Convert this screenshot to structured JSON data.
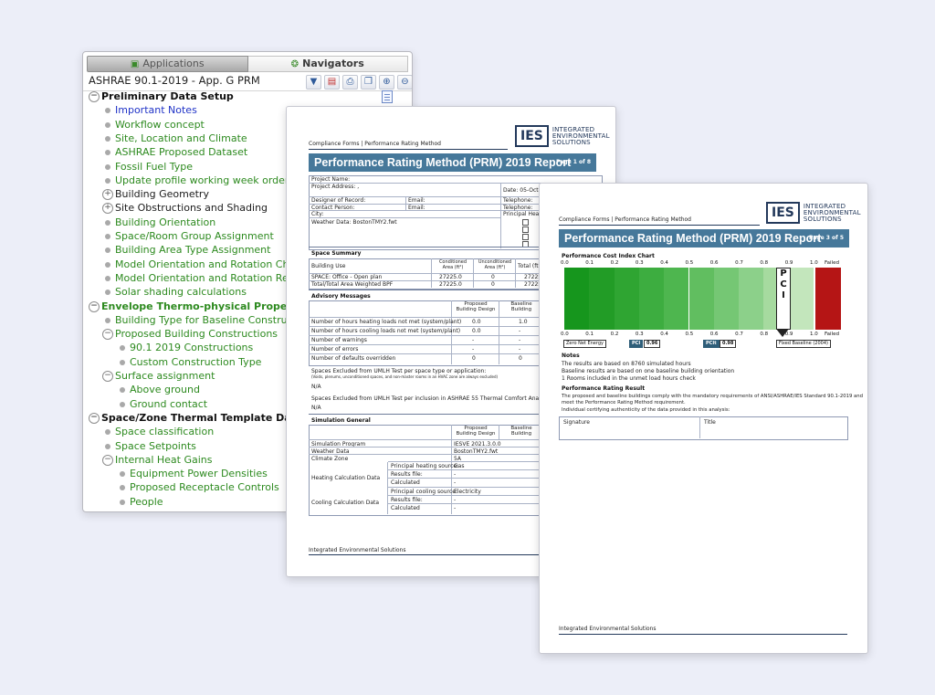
{
  "navigator": {
    "tab_applications": "Applications",
    "tab_navigators": "Navigators",
    "toolbar_title": "ASHRAE 90.1-2019 - App. G PRM",
    "items": [
      {
        "label": "Preliminary Data Setup",
        "style": "h",
        "indent": 0,
        "toggle": "⊖"
      },
      {
        "label": "Important Notes",
        "style": "b",
        "indent": 1
      },
      {
        "label": "Workflow concept",
        "style": "g",
        "indent": 1
      },
      {
        "label": "Site, Location and Climate",
        "style": "g",
        "indent": 1
      },
      {
        "label": "ASHRAE Proposed Dataset",
        "style": "g",
        "indent": 1
      },
      {
        "label": "Fossil Fuel Type",
        "style": "g",
        "indent": 1
      },
      {
        "label": "Update profile working week order",
        "style": "g",
        "indent": 1
      },
      {
        "label": "Building Geometry",
        "style": "k",
        "indent": 1,
        "toggle": "⊕"
      },
      {
        "label": "Site Obstructions and Shading",
        "style": "k",
        "indent": 1,
        "toggle": "⊕"
      },
      {
        "label": "Building Orientation",
        "style": "g",
        "indent": 1
      },
      {
        "label": "Space/Room Group Assignment",
        "style": "g",
        "indent": 1
      },
      {
        "label": "Building Area Type Assignment",
        "style": "g",
        "indent": 1
      },
      {
        "label": "Model Orientation and Rotation Check",
        "style": "g",
        "indent": 1
      },
      {
        "label": "Model Orientation and Rotation Report",
        "style": "g",
        "indent": 1
      },
      {
        "label": "Solar shading calculations",
        "style": "g",
        "indent": 1
      },
      {
        "label": "Envelope Thermo-physical Properties",
        "style": "hg",
        "indent": 0,
        "toggle": "⊖"
      },
      {
        "label": "Building Type for Baseline Construction A",
        "style": "g",
        "indent": 1
      },
      {
        "label": "Proposed Building Constructions",
        "style": "g",
        "indent": 1,
        "toggle": "⊖"
      },
      {
        "label": "90.1 2019 Constructions",
        "style": "g",
        "indent": 2
      },
      {
        "label": "Custom Construction Type",
        "style": "g",
        "indent": 2
      },
      {
        "label": "Surface assignment",
        "style": "g",
        "indent": 1,
        "toggle": "⊖"
      },
      {
        "label": "Above ground",
        "style": "g",
        "indent": 2
      },
      {
        "label": "Ground contact",
        "style": "g",
        "indent": 2
      },
      {
        "label": "Space/Zone Thermal Template Data",
        "style": "h",
        "indent": 0,
        "toggle": "⊖"
      },
      {
        "label": "Space classification",
        "style": "g",
        "indent": 1
      },
      {
        "label": "Space Setpoints",
        "style": "g",
        "indent": 1
      },
      {
        "label": "Internal Heat Gains",
        "style": "g",
        "indent": 1,
        "toggle": "⊖"
      },
      {
        "label": "Equipment Power Densities",
        "style": "g",
        "indent": 2
      },
      {
        "label": "Proposed Receptacle Controls",
        "style": "g",
        "indent": 2
      },
      {
        "label": "People",
        "style": "g",
        "indent": 2
      }
    ]
  },
  "report1": {
    "header_left": "Compliance Forms | Performance Rating Method",
    "logo": "IES",
    "logo_line1": "INTEGRATED",
    "logo_line2": "ENVIRONMENTAL",
    "logo_line3": "SOLUTIONS",
    "title": "Performance Rating Method (PRM) 2019 Report",
    "page": "Page 1 of 8",
    "project_name": "Project Name:",
    "project_address": "Project Address: ,",
    "date": "Date: 05-Oct-2021",
    "designer": "Designer of Record:",
    "contact": "Contact Person:",
    "email": "Email:",
    "telephone": "Telephone:",
    "city": "City:",
    "weather": "Weather Data: BostonTMY2.fwt",
    "principal_heating": "Principal Heating S",
    "space_summary": "Space Summary",
    "ss_building_use": "Building Use",
    "ss_conditioned": "Conditioned Area (ft²)",
    "ss_unconditioned": "Unconditioned Area (ft²)",
    "ss_total": "Total (ft²)",
    "ss_row1": [
      "SPACE: Office - Open plan",
      "27225.0",
      "0",
      "27225"
    ],
    "ss_row2": [
      "Total/Total Area Weighted BPF",
      "27225.0",
      "0",
      "27225"
    ],
    "advisory": "Advisory Messages",
    "adv_h1": "Proposed Building Design",
    "adv_h2": "Baseline Building",
    "adv_rows": [
      [
        "Number of hours heating loads not met (system/plant)",
        "0.0",
        "1.0"
      ],
      [
        "Number of hours cooling loads not met (system/plant)",
        "0.0",
        "-"
      ],
      [
        "Number of warnings",
        "-",
        "-"
      ],
      [
        "Number of errors",
        "-",
        "-"
      ],
      [
        "Number of defaults overridden",
        "0",
        "0"
      ]
    ],
    "excluded1": "Spaces Excluded from UMLH Test per space type or application:",
    "excluded1_note": "(Voids, plenums, unconditioned spaces, and non-master rooms in an HVAC zone are always excluded)",
    "na1": "N/A",
    "excluded2": "Spaces Excluded from UMLH Test per inclusion in ASHRAE 55 Thermal Comfort Analysis:",
    "na2": "N/A",
    "sim_general": "Simulation General",
    "sim_rows": [
      [
        "Simulation Program",
        "IESVE 2021.3.0.0"
      ],
      [
        "Weather Data",
        "BostonTMY2.fwt"
      ],
      [
        "Climate Zone",
        "5A"
      ]
    ],
    "heating_calc": "Heating Calculation Data",
    "cooling_calc": "Cooling Calculation Data",
    "heat_rows": [
      [
        "Principal heating source:",
        "Gas"
      ],
      [
        "Results file:",
        "-"
      ],
      [
        "Calculated",
        "-"
      ]
    ],
    "cool_rows": [
      [
        "Principal cooling source:",
        "Electricity"
      ],
      [
        "Results file:",
        "-"
      ],
      [
        "Calculated",
        "-"
      ]
    ],
    "footer": "Integrated Environmental Solutions"
  },
  "report2": {
    "header_left": "Compliance Forms | Performance Rating Method",
    "logo": "IES",
    "logo_line1": "INTEGRATED",
    "logo_line2": "ENVIRONMENTAL",
    "logo_line3": "SOLUTIONS",
    "title": "Performance Rating Method (PRM) 2019 Report",
    "page": "Page 3 of 5",
    "chart_title": "Performance Cost Index Chart",
    "ticks": [
      "0.0",
      "0.1",
      "0.2",
      "0.3",
      "0.4",
      "0.5",
      "0.6",
      "0.7",
      "0.8",
      "0.9",
      "1.0"
    ],
    "failed": "Failed",
    "pci_letters": [
      "P",
      "C",
      "I"
    ],
    "zero_net": "Zero Net Energy",
    "pci_label": "PCI",
    "pci_value": "0.96",
    "pcit_label": "PCIt",
    "pcit_value": "0.98",
    "fixed_baseline": "Fixed Baseline (2004)",
    "notes": "Notes",
    "note1": "The results are based on 8760 simulated hours",
    "note2": "Baseline results are based on one baseline building orientation",
    "note3": "1 Rooms included in the unmet load hours check",
    "result_title": "Performance Rating Result",
    "result1": "The proposed and baseline buildings comply with the mandatory requirements of ANSI/ASHRAE/IES Standard 90.1-2019 and",
    "result2": "meet the Performance Rating Method requirement.",
    "result3": "Individual certifying authenticity of the data provided in this analysis:",
    "signature": "Signature",
    "title_col": "Title",
    "footer": "Integrated Environmental Solutions",
    "colors": {
      "scale": [
        "#16961d",
        "#229c26",
        "#2fa532",
        "#3dad40",
        "#4eb64f",
        "#61be60",
        "#75c774",
        "#8cd08a",
        "#a6da9f",
        "#c3e6bc"
      ],
      "failed": "#b51515",
      "banner": "#46789a"
    }
  }
}
